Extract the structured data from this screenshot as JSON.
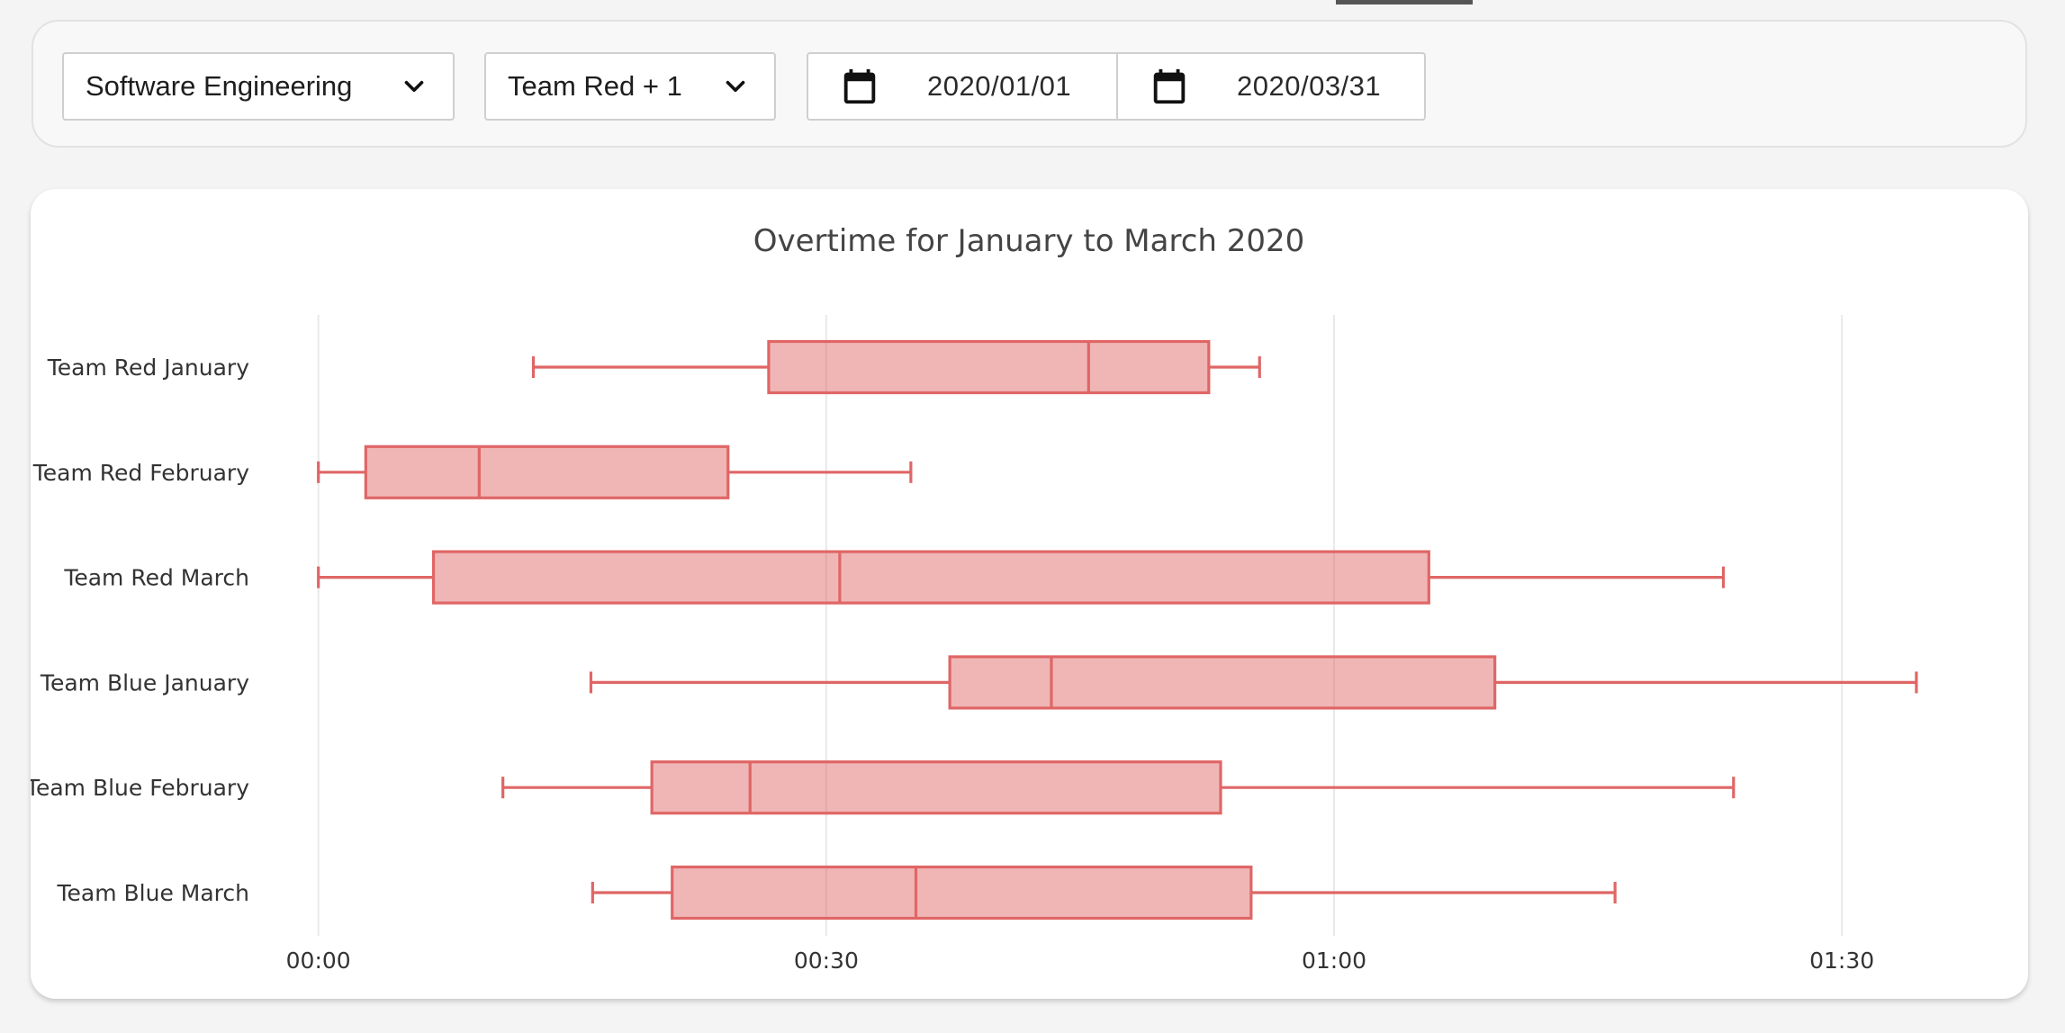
{
  "filters": {
    "department": {
      "label": "Software Engineering",
      "icon": "chevron-down-icon"
    },
    "teams": {
      "label": "Team Red + 1",
      "icon": "chevron-down-icon"
    },
    "date_range": {
      "start": "2020/01/01",
      "end": "2020/03/31",
      "icon": "calendar-icon"
    }
  },
  "chart_data": {
    "type": "box",
    "orientation": "horizontal",
    "title": "Overtime for January to March 2020",
    "x_unit": "minutes",
    "xlim": [
      -17,
      101
    ],
    "x_ticks": [
      0,
      30,
      60,
      90
    ],
    "x_tick_labels": [
      "00:00",
      "00:30",
      "01:00",
      "01:30"
    ],
    "grid": true,
    "color": "#e06666",
    "fill": "rgba(224,102,102,0.48)",
    "categories": [
      "Team Red January",
      "Team Red February",
      "Team Red March",
      "Team Blue January",
      "Team Blue February",
      "Team Blue March"
    ],
    "boxes": [
      {
        "min": 12.7,
        "q1": 26.6,
        "median": 45.5,
        "q3": 52.6,
        "max": 55.6
      },
      {
        "min": 0.0,
        "q1": 2.8,
        "median": 9.5,
        "q3": 24.2,
        "max": 35.0
      },
      {
        "min": 0.0,
        "q1": 6.8,
        "median": 30.8,
        "q3": 65.6,
        "max": 83.0
      },
      {
        "min": 16.1,
        "q1": 37.3,
        "median": 43.3,
        "q3": 69.5,
        "max": 94.4
      },
      {
        "min": 10.9,
        "q1": 19.7,
        "median": 25.5,
        "q3": 53.3,
        "max": 83.6
      },
      {
        "min": 16.2,
        "q1": 20.9,
        "median": 35.3,
        "q3": 55.1,
        "max": 76.6
      }
    ]
  }
}
